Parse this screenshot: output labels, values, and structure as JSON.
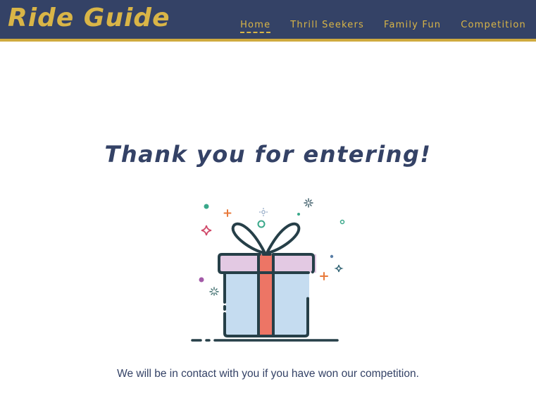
{
  "nav": {
    "brand": "Ride Guide",
    "links": [
      "Home",
      "Thrill Seekers",
      "Family Fun",
      "Competition"
    ],
    "active": "Home"
  },
  "main": {
    "heading": "Thank you for entering!",
    "illustration": "gift-box-icon",
    "message": "We will be in contact with you if you have won our competition."
  },
  "colors": {
    "nav_bg": "#344266",
    "accent": "#d9b547",
    "text": "#344266"
  }
}
